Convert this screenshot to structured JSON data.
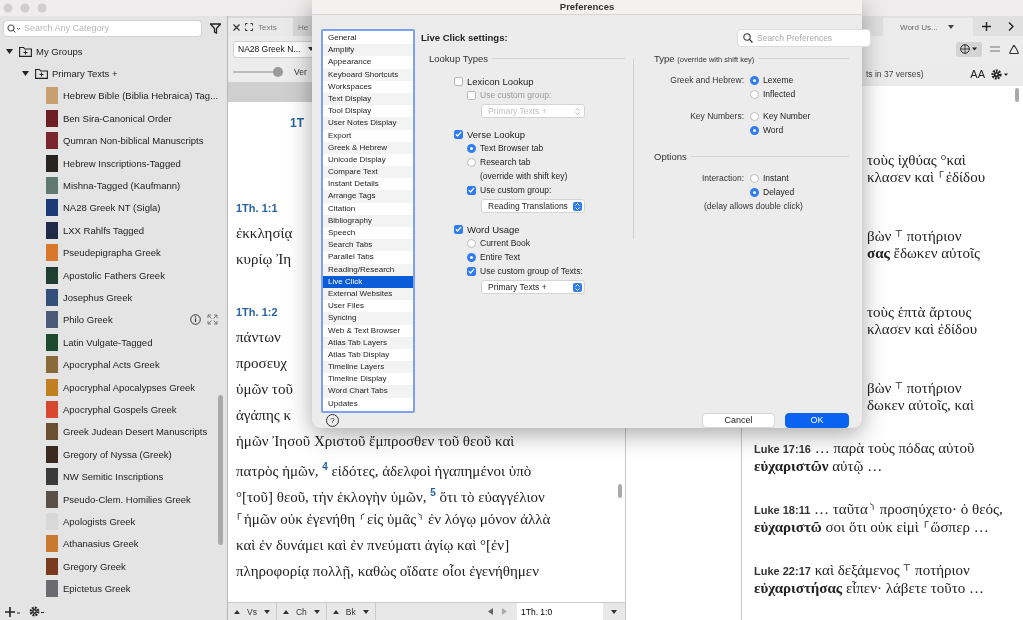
{
  "sidebar": {
    "search_placeholder": "Search Any Category",
    "tree": [
      {
        "label": "My Groups",
        "expanded": true,
        "children": [
          {
            "label": "Primary Texts +",
            "expanded": true,
            "children": [
              {
                "label": "Hebrew Bible (Biblia Hebraica) Tag...",
                "color": "#c8a070",
                "hovered": false
              },
              {
                "label": "Ben Sira-Canonical Order",
                "color": "#6e1f24",
                "hovered": false
              },
              {
                "label": "Qumran Non-biblical Manuscripts",
                "color": "#7a2430",
                "hovered": false
              },
              {
                "label": "Hebrew Inscriptions-Tagged",
                "color": "#2a2420",
                "hovered": false
              },
              {
                "label": "Mishna-Tagged (Kaufmann)",
                "color": "#5f7a70",
                "hovered": false
              },
              {
                "label": "NA28 Greek NT (Sigla)",
                "color": "#1d3a78",
                "hovered": false
              },
              {
                "label": "LXX Rahlfs Tagged",
                "color": "#1e2a48",
                "hovered": false
              },
              {
                "label": "Pseudepigrapha Greek",
                "color": "#d9782c",
                "hovered": false
              },
              {
                "label": "Apostolic Fathers Greek",
                "color": "#1f3d30",
                "hovered": false
              },
              {
                "label": "Josephus Greek",
                "color": "#34507a",
                "hovered": false
              },
              {
                "label": "Philo Greek",
                "color": "#4a5a78",
                "hovered": true
              },
              {
                "label": "Latin Vulgate-Tagged",
                "color": "#1e4a30",
                "hovered": false
              },
              {
                "label": "Apocryphal Acts Greek",
                "color": "#8a6a3a",
                "hovered": false
              },
              {
                "label": "Apocryphal Apocalypses Greek",
                "color": "#c08020",
                "hovered": false
              },
              {
                "label": "Apocryphal Gospels Greek",
                "color": "#d84830",
                "hovered": false
              },
              {
                "label": "Greek Judean Desert Manuscripts",
                "color": "#6a5030",
                "hovered": false
              },
              {
                "label": "Gregory of Nyssa (Greek)",
                "color": "#3a2a20",
                "hovered": false
              },
              {
                "label": "NW Semitic Inscriptions",
                "color": "#3a3a3a",
                "hovered": false
              },
              {
                "label": "Pseudo-Clem. Homilies Greek",
                "color": "#5a5048",
                "hovered": false
              },
              {
                "label": "Apologists Greek",
                "color": "#d8d8d8",
                "hovered": false
              },
              {
                "label": "Athanasius Greek",
                "color": "#c87a30",
                "hovered": false
              },
              {
                "label": "Gregory Greek",
                "color": "#7a3a20",
                "hovered": false
              },
              {
                "label": "Epictetus Greek",
                "color": "#6a6a70",
                "hovered": false
              }
            ]
          }
        ]
      }
    ]
  },
  "text_pane": {
    "tabs": [
      {
        "label": "Texts",
        "selected": true
      },
      {
        "label": "He",
        "selected": false
      }
    ],
    "text_selector": "NA28 Greek N...",
    "slider": {
      "label": "Ver",
      "level": 0.9
    },
    "heading": "1T",
    "verses": [
      {
        "ref": "1Th. 1:1",
        "lines": [
          "ἐκκλησίᾳ",
          "κυρίῳ Ἰη"
        ]
      },
      {
        "ref": "1Th. 1:2",
        "lines": [
          "πάντων",
          "προσευχ",
          "ὑμῶν τοῦ",
          "ἀγάπης κ",
          "ἡμῶν Ἰησοῦ Χριστοῦ ἔμπροσθεν τοῦ θεοῦ καὶ",
          "πατρὸς ἡμῶν, $^{4}$ εἰδότες, ἀδελφοὶ ἠγαπημένοι ὑπὸ",
          "°[τοῦ] θεοῦ, τὴν ἐκλογὴν ὑμῶν, $^{5}$ ὅτι τὸ εὐαγγέλιον",
          "⸀ἡμῶν οὐκ ἐγενήθη ⸂εἰς ὑμᾶς⸃ ἐν λόγῳ μόνον ἀλλὰ",
          "καὶ ἐν δυνάμει καὶ ἐν πνεύματι ἁγίῳ καὶ °[ἐν]",
          "πληροφορίᾳ πολλῇ, καθὼς οἴδατε οἷοι ἐγενήθημεν"
        ]
      }
    ],
    "nav_buttons": [
      "Vs",
      "Ch",
      "Bk"
    ],
    "reference": "1Th. 1:0"
  },
  "usage_pane": {
    "tab": "Word Us...",
    "summary": "ts in 37 verses)",
    "font_size_label": "AA",
    "entries": [
      {
        "kind": "partial",
        "lines": [
          "τοὺς ἰχθύας °καὶ",
          "κλασεν καὶ ⸀ἐδίδου"
        ]
      },
      {
        "kind": "partial",
        "lines": [
          "βὼν ⸆ ποτήριον",
          "**σας** ἔδωκεν αὐτοῖς"
        ]
      },
      {
        "kind": "partial",
        "lines": [
          "τοὺς ἑπτὰ ἄρτους",
          "κλασεν καὶ ἐδίδου"
        ]
      },
      {
        "kind": "partial",
        "lines": [
          "βὼν ⸆ ποτήριον",
          "δωκεν αὐτοῖς, καὶ"
        ]
      },
      {
        "kind": "full",
        "ref": "Luke 17:16",
        "text": "… παρὰ τοὺς πόδας αὐτοῦ **εὐχαριστῶν** αὐτῷ …"
      },
      {
        "kind": "full",
        "ref": "Luke 18:11",
        "text": "… ταῦτα⸃ προσηύχετο· ὁ θεός, **εὐχαριστῶ** σοι ὅτι οὐκ εἰμὶ ⸀ὥσπερ …"
      },
      {
        "kind": "full",
        "ref": "Luke 22:17",
        "text": "καὶ δεξάμενος ⸆ ποτήριον **εὐχαριστήσας** εἶπεν· λάβετε τοῦτο …"
      }
    ]
  },
  "dialog": {
    "title": "Preferences",
    "heading": "Live Click settings:",
    "search_placeholder": "Search Preferences",
    "help": "?",
    "categories": [
      {
        "label": "General",
        "selected": false
      },
      {
        "label": "Amplify",
        "selected": false
      },
      {
        "label": "Appearance",
        "selected": false
      },
      {
        "label": "Keyboard Shortcuts",
        "selected": false
      },
      {
        "label": "Workspaces",
        "selected": false
      },
      {
        "label": "Text Display",
        "selected": false
      },
      {
        "label": "Tool Display",
        "selected": false
      },
      {
        "label": "User Notes Display",
        "selected": false
      },
      {
        "label": "Export",
        "selected": false
      },
      {
        "label": "Greek & Hebrew",
        "selected": false
      },
      {
        "label": "Unicode Display",
        "selected": false
      },
      {
        "label": "Compare Text",
        "selected": false
      },
      {
        "label": "Instant Details",
        "selected": false
      },
      {
        "label": "Arrange Tags",
        "selected": false
      },
      {
        "label": "Citation",
        "selected": false
      },
      {
        "label": "Bibliography",
        "selected": false
      },
      {
        "label": "Speech",
        "selected": false
      },
      {
        "label": "Search Tabs",
        "selected": false
      },
      {
        "label": "Parallel Tabs",
        "selected": false
      },
      {
        "label": "Reading/Research",
        "selected": false
      },
      {
        "label": "Live Click",
        "selected": true
      },
      {
        "label": "External Websites",
        "selected": false
      },
      {
        "label": "User Files",
        "selected": false
      },
      {
        "label": "Syncing",
        "selected": false
      },
      {
        "label": "Web & Text Browser",
        "selected": false
      },
      {
        "label": "Atlas Tab Layers",
        "selected": false
      },
      {
        "label": "Atlas Tab Display",
        "selected": false
      },
      {
        "label": "Timeline Layers",
        "selected": false
      },
      {
        "label": "Timeline Display",
        "selected": false
      },
      {
        "label": "Word Chart Tabs",
        "selected": false
      },
      {
        "label": "Updates",
        "selected": false
      }
    ],
    "lookup_types": {
      "title": "Lookup Types",
      "groups": [
        {
          "label": "Lexicon Lookup",
          "checked": false,
          "custom": {
            "label": "Use custom group:",
            "checked": false,
            "disabled": true,
            "value": "Primary Texts +"
          }
        },
        {
          "label": "Verse Lookup",
          "checked": true,
          "options": [
            {
              "label": "Text Browser tab",
              "selected": true
            },
            {
              "label": "Research tab",
              "selected": false
            }
          ],
          "note": "(override with shift key)",
          "custom": {
            "label": "Use custom group:",
            "checked": true,
            "disabled": false,
            "value": "Reading Translations"
          }
        },
        {
          "label": "Word Usage",
          "checked": true,
          "options": [
            {
              "label": "Current Book",
              "selected": false
            },
            {
              "label": "Entire Text",
              "selected": true
            }
          ],
          "custom": {
            "label": "Use custom group of Texts:",
            "checked": true,
            "disabled": false,
            "value": "Primary Texts +"
          }
        }
      ]
    },
    "type": {
      "title": "Type",
      "subtitle": "(override with shift key)",
      "rows": [
        {
          "label": "Greek and Hebrew:",
          "options": [
            {
              "label": "Lexeme",
              "selected": true
            },
            {
              "label": "Inflected",
              "selected": false
            }
          ]
        },
        {
          "label": "Key Numbers:",
          "options": [
            {
              "label": "Key Number",
              "selected": false
            },
            {
              "label": "Word",
              "selected": true
            }
          ]
        }
      ]
    },
    "options": {
      "title": "Options",
      "rows": [
        {
          "label": "Interaction:",
          "options": [
            {
              "label": "Instant",
              "selected": false
            },
            {
              "label": "Delayed",
              "selected": true
            }
          ]
        }
      ],
      "note": "(delay allows double click)"
    },
    "buttons": [
      {
        "label": "Cancel",
        "kind": "secondary"
      },
      {
        "label": "OK",
        "kind": "primary"
      }
    ]
  }
}
